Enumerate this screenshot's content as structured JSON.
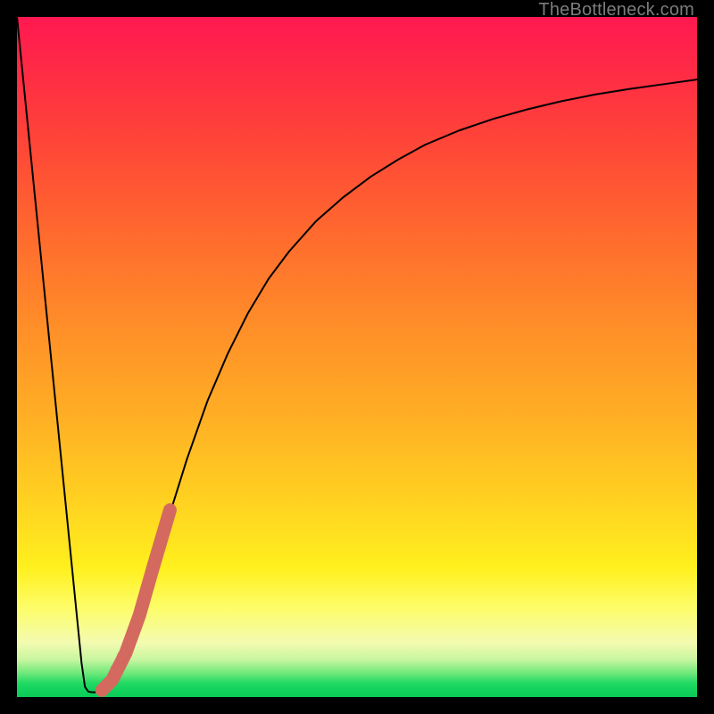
{
  "watermark": "TheBottleneck.com",
  "chart_data": {
    "type": "line",
    "title": "",
    "xlabel": "",
    "ylabel": "",
    "xlim": [
      0,
      100
    ],
    "ylim": [
      0,
      100
    ],
    "series": [
      {
        "name": "bottleneck-curve",
        "x": [
          0.0,
          2.0,
          4.0,
          6.0,
          8.0,
          9.0,
          9.5,
          10.0,
          10.5,
          11.0,
          11.5,
          12.5,
          14.0,
          16.0,
          18.0,
          20.0,
          22.5,
          25.0,
          28.0,
          31.0,
          34.0,
          37.0,
          40.0,
          44.0,
          48.0,
          52.0,
          56.0,
          60.0,
          65.0,
          70.0,
          75.0,
          80.0,
          85.0,
          90.0,
          95.0,
          100.0
        ],
        "y": [
          100.0,
          80.0,
          60.0,
          40.0,
          20.0,
          10.0,
          5.0,
          1.5,
          0.8,
          0.7,
          0.7,
          1.0,
          2.5,
          6.5,
          12.0,
          19.0,
          27.0,
          35.0,
          43.5,
          50.5,
          56.5,
          61.5,
          65.5,
          70.0,
          73.5,
          76.5,
          79.0,
          81.2,
          83.3,
          85.0,
          86.4,
          87.6,
          88.6,
          89.4,
          90.1,
          90.8
        ]
      }
    ],
    "highlight_segment": {
      "name": "highlighted-range",
      "x": [
        12.5,
        14.0,
        16.0,
        18.0,
        20.0,
        22.5
      ],
      "y": [
        1.0,
        2.5,
        6.5,
        12.0,
        19.0,
        27.5
      ]
    },
    "highlight_dots": {
      "name": "highlight-dots",
      "points": [
        {
          "x": 14.5,
          "y": 4.0
        },
        {
          "x": 15.5,
          "y": 6.0
        },
        {
          "x": 13.5,
          "y": 2.0
        }
      ]
    },
    "colors": {
      "curve": "#000000",
      "highlight": "#d46a5f"
    }
  }
}
